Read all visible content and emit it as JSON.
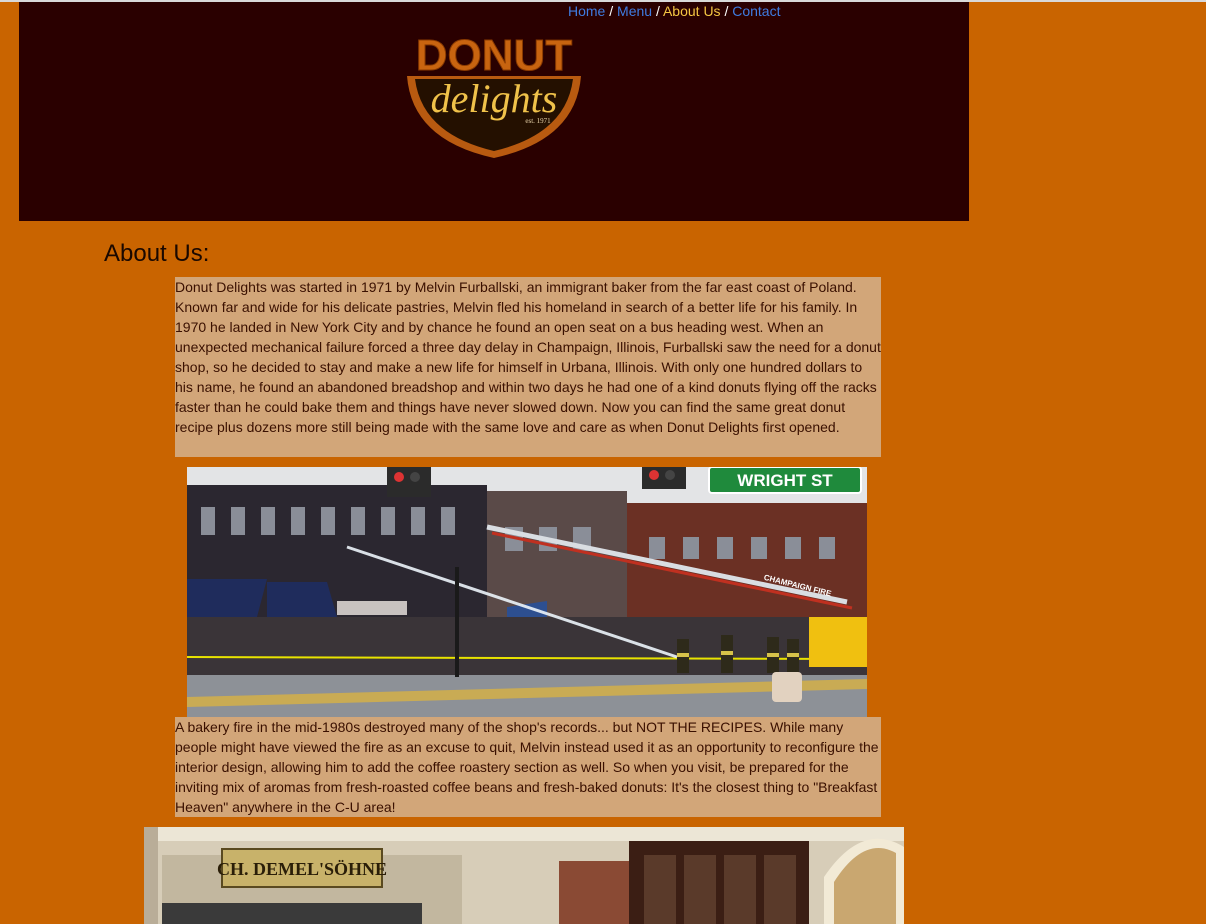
{
  "nav": {
    "items": [
      {
        "label": "Home"
      },
      {
        "label": "Menu"
      },
      {
        "label": "About Us"
      },
      {
        "label": "Contact"
      }
    ],
    "separator": "/",
    "active_index": 2
  },
  "logo": {
    "line1": "DONUT",
    "line2": "delights",
    "est": "est. 1971"
  },
  "about": {
    "heading": "About Us:",
    "paragraph1": "Donut Delights was started in 1971 by Melvin Furballski, an immigrant baker from the far east coast of Poland. Known far and wide for his delicate pastries, Melvin fled his homeland in search of a better life for his family. In 1970 he landed in New York City and by chance he found an open seat on a bus heading west. When an unexpected mechanical failure forced a three day delay in Champaign, Illinois, Furballski saw the need for a donut shop, so he decided to stay and make a new life for himself in Urbana, Illinois. With only one hundred dollars to his name, he found an abandoned breadshop and within two days he had one of a kind donuts flying off the racks faster than he could bake them and things have never slowed down. Now you can find the same great donut recipe plus dozens more still being made with the same love and care as when Donut Delights first opened.",
    "paragraph2": "A bakery fire in the mid-1980s destroyed many of the shop's records... but NOT THE RECIPES. While many people might have viewed the fire as an excuse to quit, Melvin instead used it as an opportunity to reconfigure the interior design, allowing him to add the coffee roastery section as well. So when you visit, be prepared for the inviting mix of aromas from fresh-roasted coffee beans and fresh-baked donuts: It's the closest thing to \"Breakfast Heaven\" anywhere in the C-U area!"
  },
  "photos": {
    "fire_sign": "WRIGHT ST",
    "fire_truck_text": "CHAMPAIGN FIRE",
    "shop_sign": "CH. DEMEL'SÖHNE"
  },
  "colors": {
    "page_background": "#c96400",
    "header_background": "#2a0000",
    "text_box": "#d2a679",
    "nav_link": "#3f7be0",
    "nav_active": "#f5c542"
  }
}
